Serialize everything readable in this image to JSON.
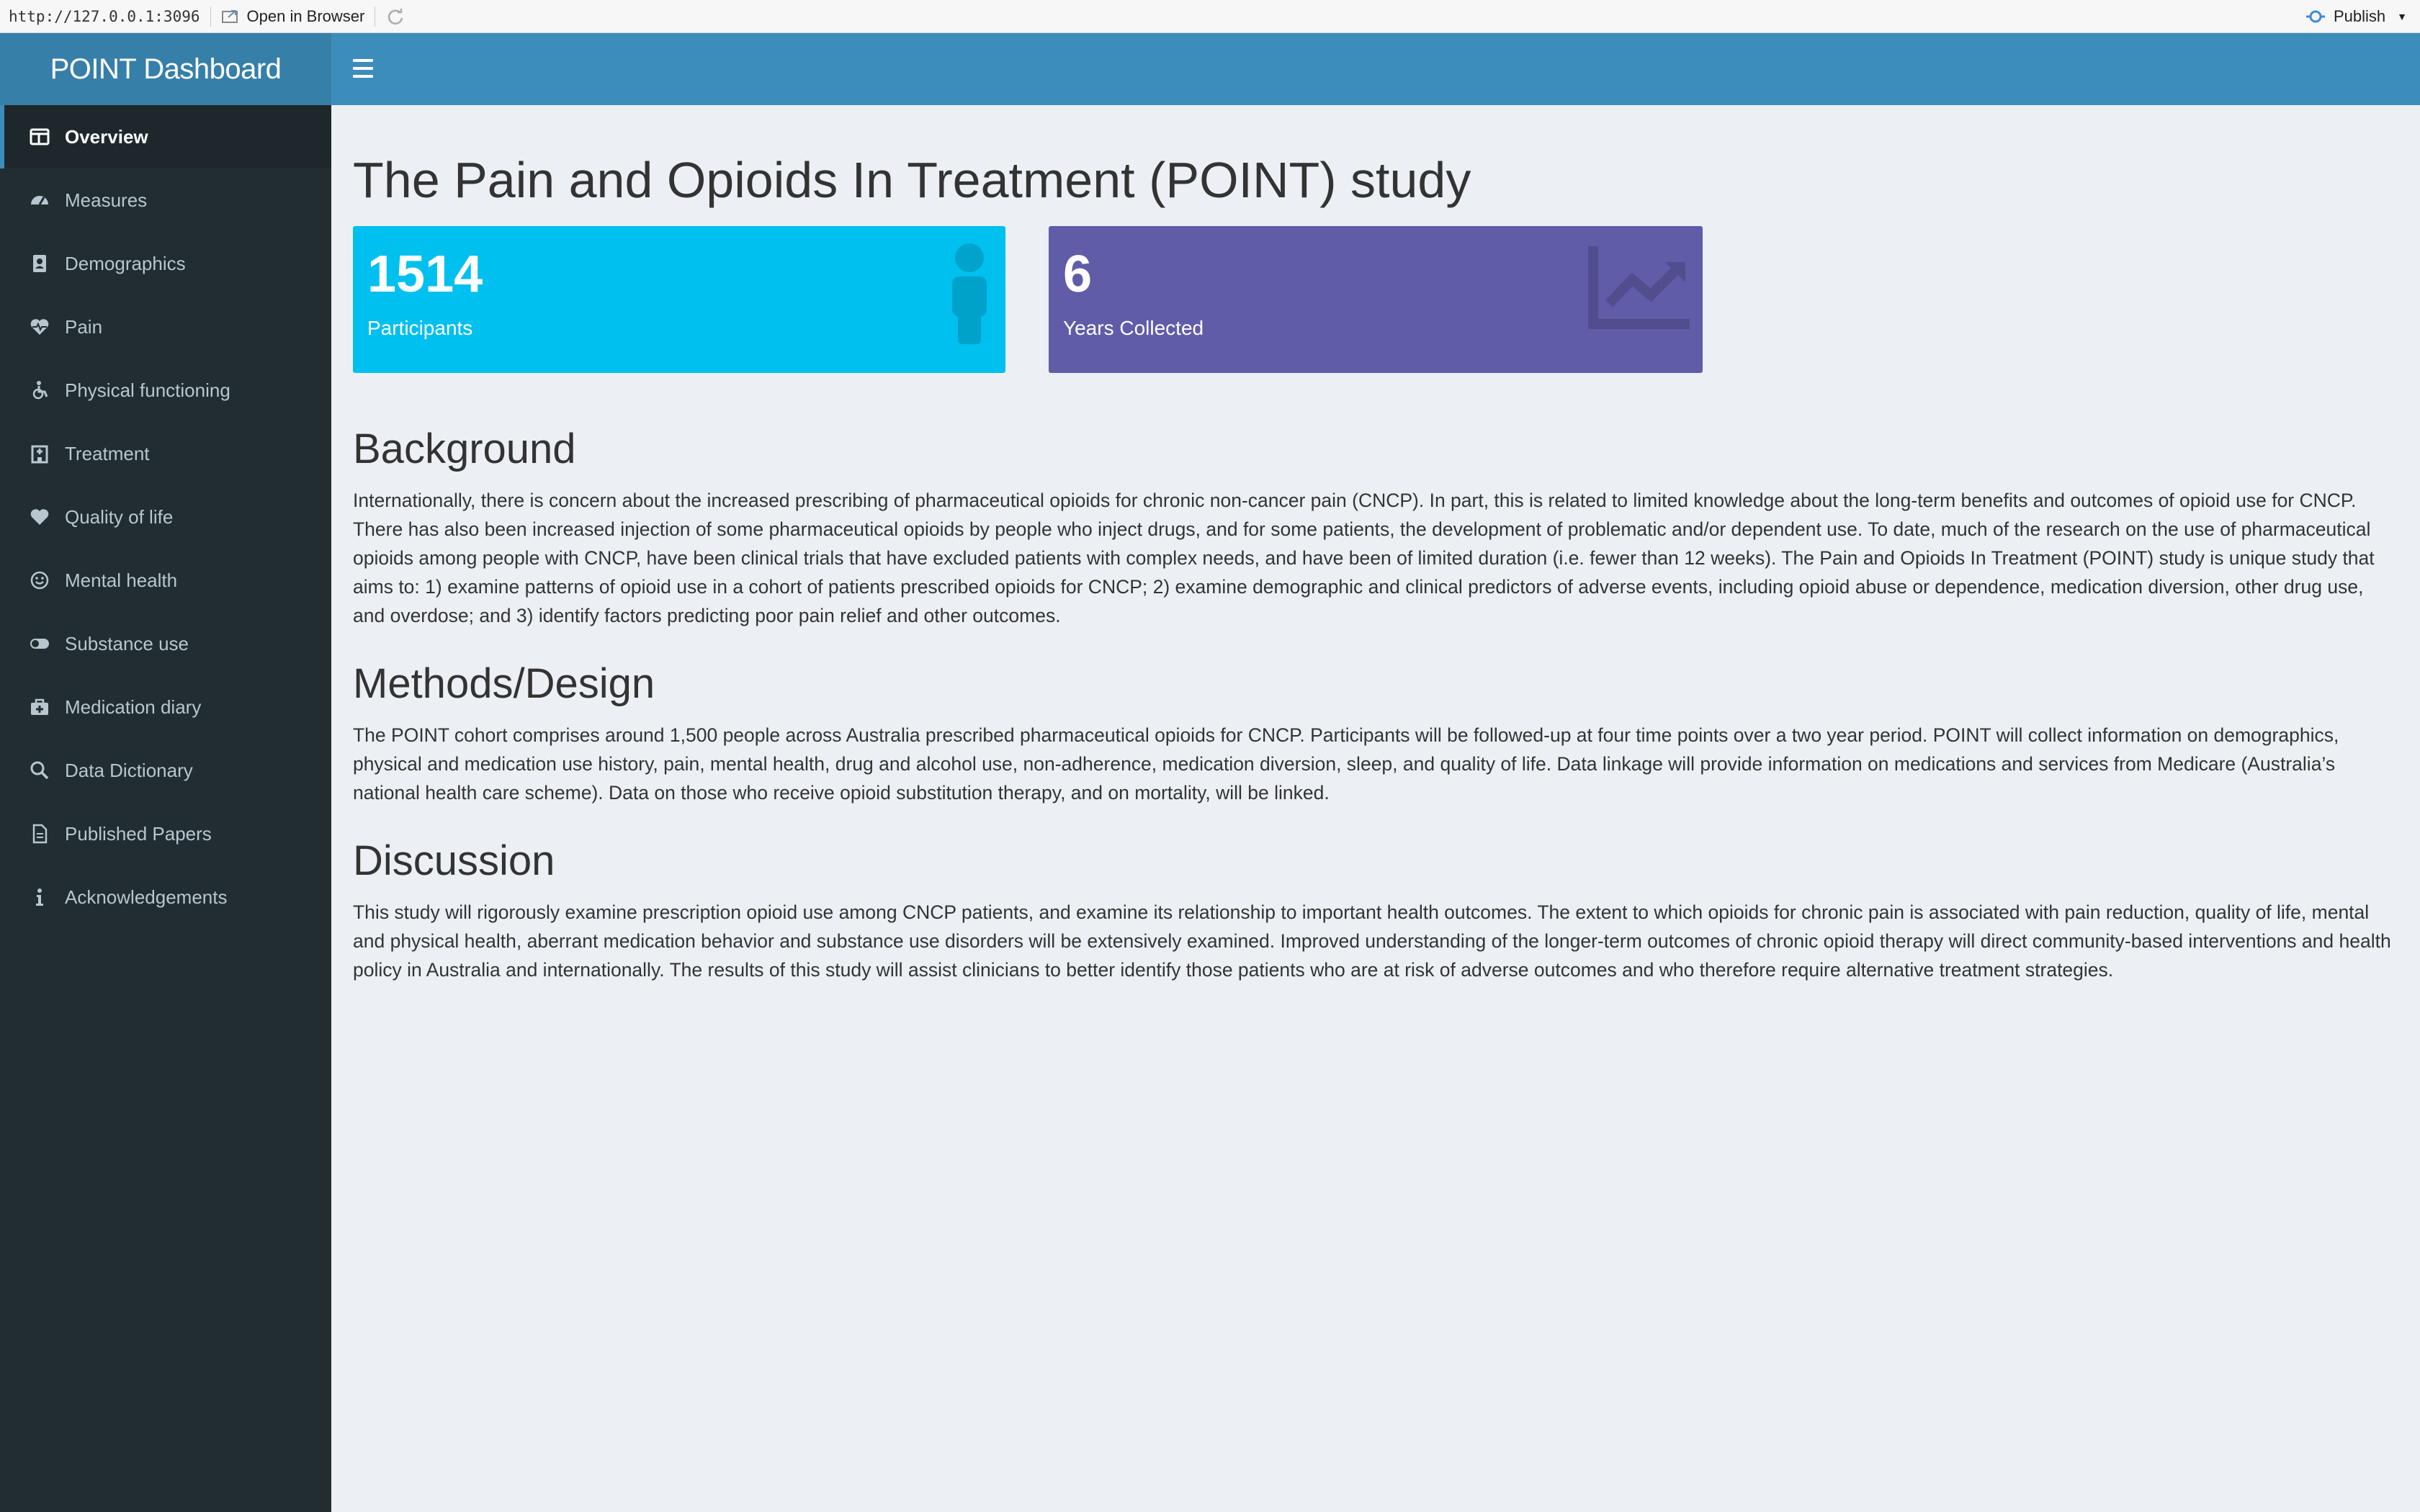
{
  "viewer": {
    "url": "http://127.0.0.1:3096",
    "open_in_browser": "Open in Browser",
    "publish": "Publish"
  },
  "header": {
    "brand": "POINT Dashboard"
  },
  "sidebar": {
    "items": [
      {
        "label": "Overview",
        "icon": "table-icon"
      },
      {
        "label": "Measures",
        "icon": "dashboard-icon"
      },
      {
        "label": "Demographics",
        "icon": "address-book-icon"
      },
      {
        "label": "Pain",
        "icon": "heartbeat-icon"
      },
      {
        "label": "Physical functioning",
        "icon": "wheelchair-icon"
      },
      {
        "label": "Treatment",
        "icon": "hospital-icon"
      },
      {
        "label": "Quality of life",
        "icon": "heart-icon"
      },
      {
        "label": "Mental health",
        "icon": "smile-icon"
      },
      {
        "label": "Substance use",
        "icon": "toggle-icon"
      },
      {
        "label": "Medication diary",
        "icon": "medkit-icon"
      },
      {
        "label": "Data Dictionary",
        "icon": "search-icon"
      },
      {
        "label": "Published Papers",
        "icon": "file-icon"
      },
      {
        "label": "Acknowledgements",
        "icon": "info-icon"
      }
    ],
    "active_index": 0
  },
  "main": {
    "title": "The Pain and Opioids In Treatment (POINT) study",
    "info_boxes": [
      {
        "value": "1514",
        "label": "Participants",
        "color": "#00c0ef",
        "icon": "user-icon"
      },
      {
        "value": "6",
        "label": "Years Collected",
        "color": "#605ca8",
        "icon": "line-chart-icon"
      }
    ],
    "sections": [
      {
        "heading": "Background",
        "body": "Internationally, there is concern about the increased prescribing of pharmaceutical opioids for chronic non-cancer pain (CNCP). In part, this is related to limited knowledge about the long-term benefits and outcomes of opioid use for CNCP. There has also been increased injection of some pharmaceutical opioids by people who inject drugs, and for some patients, the development of problematic and/or dependent use. To date, much of the research on the use of pharmaceutical opioids among people with CNCP, have been clinical trials that have excluded patients with complex needs, and have been of limited duration (i.e. fewer than 12 weeks). The Pain and Opioids In Treatment (POINT) study is unique study that aims to: 1) examine patterns of opioid use in a cohort of patients prescribed opioids for CNCP; 2) examine demographic and clinical predictors of adverse events, including opioid abuse or dependence, medication diversion, other drug use, and overdose; and 3) identify factors predicting poor pain relief and other outcomes."
      },
      {
        "heading": "Methods/Design",
        "body": "The POINT cohort comprises around 1,500 people across Australia prescribed pharmaceutical opioids for CNCP. Participants will be followed-up at four time points over a two year period. POINT will collect information on demographics, physical and medication use history, pain, mental health, drug and alcohol use, non-adherence, medication diversion, sleep, and quality of life. Data linkage will provide information on medications and services from Medicare (Australia’s national health care scheme). Data on those who receive opioid substitution therapy, and on mortality, will be linked."
      },
      {
        "heading": "Discussion",
        "body": "This study will rigorously examine prescription opioid use among CNCP patients, and examine its relationship to important health outcomes. The extent to which opioids for chronic pain is associated with pain reduction, quality of life, mental and physical health, aberrant medication behavior and substance use disorders will be extensively examined. Improved understanding of the longer-term outcomes of chronic opioid therapy will direct community-based interventions and health policy in Australia and internationally. The results of this study will assist clinicians to better identify those patients who are at risk of adverse outcomes and who therefore require alternative treatment strategies."
      }
    ]
  }
}
